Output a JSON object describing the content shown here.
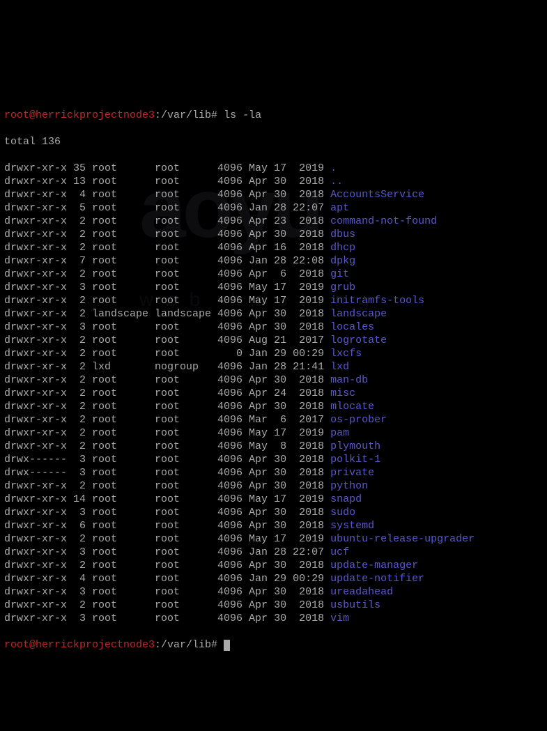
{
  "prompt_user": "root@herrickprojectnode3",
  "prompt_path": ":/var/lib#",
  "command": " ls -la",
  "total_line": "total 136",
  "rows": [
    {
      "perms": "drwxr-xr-x",
      "links": "35",
      "owner": "root",
      "group": "root",
      "size": "4096",
      "date": "May 17  2019",
      "name": ".",
      "color": "blue"
    },
    {
      "perms": "drwxr-xr-x",
      "links": "13",
      "owner": "root",
      "group": "root",
      "size": "4096",
      "date": "Apr 30  2018",
      "name": "..",
      "color": "blue"
    },
    {
      "perms": "drwxr-xr-x",
      "links": " 4",
      "owner": "root",
      "group": "root",
      "size": "4096",
      "date": "Apr 30  2018",
      "name": "AccountsService",
      "color": "blue"
    },
    {
      "perms": "drwxr-xr-x",
      "links": " 5",
      "owner": "root",
      "group": "root",
      "size": "4096",
      "date": "Jan 28 22:07",
      "name": "apt",
      "color": "blue"
    },
    {
      "perms": "drwxr-xr-x",
      "links": " 2",
      "owner": "root",
      "group": "root",
      "size": "4096",
      "date": "Apr 23  2018",
      "name": "command-not-found",
      "color": "blue"
    },
    {
      "perms": "drwxr-xr-x",
      "links": " 2",
      "owner": "root",
      "group": "root",
      "size": "4096",
      "date": "Apr 30  2018",
      "name": "dbus",
      "color": "blue"
    },
    {
      "perms": "drwxr-xr-x",
      "links": " 2",
      "owner": "root",
      "group": "root",
      "size": "4096",
      "date": "Apr 16  2018",
      "name": "dhcp",
      "color": "blue"
    },
    {
      "perms": "drwxr-xr-x",
      "links": " 7",
      "owner": "root",
      "group": "root",
      "size": "4096",
      "date": "Jan 28 22:08",
      "name": "dpkg",
      "color": "blue"
    },
    {
      "perms": "drwxr-xr-x",
      "links": " 2",
      "owner": "root",
      "group": "root",
      "size": "4096",
      "date": "Apr  6  2018",
      "name": "git",
      "color": "blue"
    },
    {
      "perms": "drwxr-xr-x",
      "links": " 3",
      "owner": "root",
      "group": "root",
      "size": "4096",
      "date": "May 17  2019",
      "name": "grub",
      "color": "blue"
    },
    {
      "perms": "drwxr-xr-x",
      "links": " 2",
      "owner": "root",
      "group": "root",
      "size": "4096",
      "date": "May 17  2019",
      "name": "initramfs-tools",
      "color": "blue"
    },
    {
      "perms": "drwxr-xr-x",
      "links": " 2",
      "owner": "landscape",
      "group": "landscape",
      "size": "4096",
      "date": "Apr 30  2018",
      "name": "landscape",
      "color": "blue"
    },
    {
      "perms": "drwxr-xr-x",
      "links": " 3",
      "owner": "root",
      "group": "root",
      "size": "4096",
      "date": "Apr 30  2018",
      "name": "locales",
      "color": "blue"
    },
    {
      "perms": "drwxr-xr-x",
      "links": " 2",
      "owner": "root",
      "group": "root",
      "size": "4096",
      "date": "Aug 21  2017",
      "name": "logrotate",
      "color": "blue"
    },
    {
      "perms": "drwxr-xr-x",
      "links": " 2",
      "owner": "root",
      "group": "root",
      "size": "   0",
      "date": "Jan 29 00:29",
      "name": "lxcfs",
      "color": "blue"
    },
    {
      "perms": "drwxr-xr-x",
      "links": " 2",
      "owner": "lxd",
      "group": "nogroup",
      "size": "4096",
      "date": "Jan 28 21:41",
      "name": "lxd",
      "color": "blue"
    },
    {
      "perms": "drwxr-xr-x",
      "links": " 2",
      "owner": "root",
      "group": "root",
      "size": "4096",
      "date": "Apr 30  2018",
      "name": "man-db",
      "color": "blue"
    },
    {
      "perms": "drwxr-xr-x",
      "links": " 2",
      "owner": "root",
      "group": "root",
      "size": "4096",
      "date": "Apr 24  2018",
      "name": "misc",
      "color": "blue"
    },
    {
      "perms": "drwxr-xr-x",
      "links": " 2",
      "owner": "root",
      "group": "root",
      "size": "4096",
      "date": "Apr 30  2018",
      "name": "mlocate",
      "color": "blue"
    },
    {
      "perms": "drwxr-xr-x",
      "links": " 2",
      "owner": "root",
      "group": "root",
      "size": "4096",
      "date": "Mar  6  2017",
      "name": "os-prober",
      "color": "blue"
    },
    {
      "perms": "drwxr-xr-x",
      "links": " 2",
      "owner": "root",
      "group": "root",
      "size": "4096",
      "date": "May 17  2019",
      "name": "pam",
      "color": "blue"
    },
    {
      "perms": "drwxr-xr-x",
      "links": " 2",
      "owner": "root",
      "group": "root",
      "size": "4096",
      "date": "May  8  2018",
      "name": "plymouth",
      "color": "blue"
    },
    {
      "perms": "drwx------",
      "links": " 3",
      "owner": "root",
      "group": "root",
      "size": "4096",
      "date": "Apr 30  2018",
      "name": "polkit-1",
      "color": "blue"
    },
    {
      "perms": "drwx------",
      "links": " 3",
      "owner": "root",
      "group": "root",
      "size": "4096",
      "date": "Apr 30  2018",
      "name": "private",
      "color": "blue"
    },
    {
      "perms": "drwxr-xr-x",
      "links": " 2",
      "owner": "root",
      "group": "root",
      "size": "4096",
      "date": "Apr 30  2018",
      "name": "python",
      "color": "blue"
    },
    {
      "perms": "drwxr-xr-x",
      "links": "14",
      "owner": "root",
      "group": "root",
      "size": "4096",
      "date": "May 17  2019",
      "name": "snapd",
      "color": "blue"
    },
    {
      "perms": "drwxr-xr-x",
      "links": " 3",
      "owner": "root",
      "group": "root",
      "size": "4096",
      "date": "Apr 30  2018",
      "name": "sudo",
      "color": "blue"
    },
    {
      "perms": "drwxr-xr-x",
      "links": " 6",
      "owner": "root",
      "group": "root",
      "size": "4096",
      "date": "Apr 30  2018",
      "name": "systemd",
      "color": "blue"
    },
    {
      "perms": "drwxr-xr-x",
      "links": " 2",
      "owner": "root",
      "group": "root",
      "size": "4096",
      "date": "May 17  2019",
      "name": "ubuntu-release-upgrader",
      "color": "blue"
    },
    {
      "perms": "drwxr-xr-x",
      "links": " 3",
      "owner": "root",
      "group": "root",
      "size": "4096",
      "date": "Jan 28 22:07",
      "name": "ucf",
      "color": "blue"
    },
    {
      "perms": "drwxr-xr-x",
      "links": " 2",
      "owner": "root",
      "group": "root",
      "size": "4096",
      "date": "Apr 30  2018",
      "name": "update-manager",
      "color": "blue"
    },
    {
      "perms": "drwxr-xr-x",
      "links": " 4",
      "owner": "root",
      "group": "root",
      "size": "4096",
      "date": "Jan 29 00:29",
      "name": "update-notifier",
      "color": "blue"
    },
    {
      "perms": "drwxr-xr-x",
      "links": " 3",
      "owner": "root",
      "group": "root",
      "size": "4096",
      "date": "Apr 30  2018",
      "name": "ureadahead",
      "color": "blue"
    },
    {
      "perms": "drwxr-xr-x",
      "links": " 2",
      "owner": "root",
      "group": "root",
      "size": "4096",
      "date": "Apr 30  2018",
      "name": "usbutils",
      "color": "blue"
    },
    {
      "perms": "drwxr-xr-x",
      "links": " 3",
      "owner": "root",
      "group": "root",
      "size": "4096",
      "date": "Apr 30  2018",
      "name": "vim",
      "color": "blue"
    }
  ],
  "watermark_main": "aoyu",
  "watermark_sub": "web hosting"
}
